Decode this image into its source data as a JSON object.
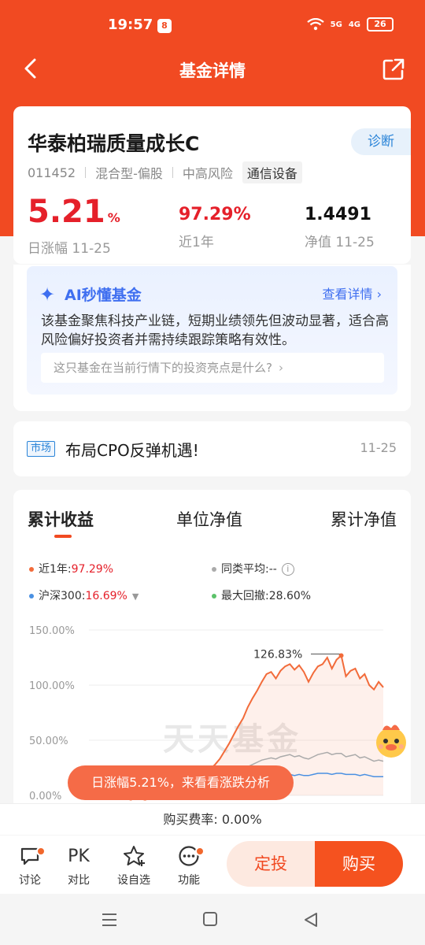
{
  "status": {
    "time": "19:57",
    "app_glyph": "8",
    "network1": "5G",
    "network2": "4G",
    "battery": "26"
  },
  "nav": {
    "title": "基金详情"
  },
  "fund": {
    "name": "华泰柏瑞质量成长C",
    "diagnose_label": "诊断",
    "code": "011452",
    "type": "混合型-偏股",
    "risk": "中高风险",
    "sector": "通信设备",
    "daily_change_value": "5.21",
    "daily_change_unit": "%",
    "daily_change_label": "日涨幅 11-25",
    "year_return_value": "97.29%",
    "year_return_label": "近1年",
    "nav_value": "1.4491",
    "nav_label": "净值 11-25"
  },
  "ai": {
    "title": "AI秒懂基金",
    "more": "查看详情",
    "description": "该基金聚焦科技产业链，短期业绩领先但波动显著，适合高风险偏好投资者并需持续跟踪策略有效性。",
    "question": "这只基金在当前行情下的投资亮点是什么?"
  },
  "news": {
    "tag": "市场",
    "text": "布局CPO反弹机遇!",
    "date": "11-25"
  },
  "chart_tabs": [
    "累计收益",
    "单位净值",
    "累计净值"
  ],
  "legend": {
    "near_year_label": "近1年:",
    "near_year_value": "97.29%",
    "peer_label": "同类平均:--",
    "hs300_label": "沪深300:",
    "hs300_value": "16.69%",
    "drawdown_label": "最大回撤:28.60%"
  },
  "colors": {
    "fund": "#f26b3a",
    "peer": "#aaaaaa",
    "hs300": "#4a90e2",
    "drawdown": "#5cc26a",
    "accent": "#f14a22"
  },
  "chart_data": {
    "type": "line",
    "yticks": [
      "150.00%",
      "100.00%",
      "50.00%",
      "0.00%"
    ],
    "ylim": [
      0,
      150
    ],
    "peak_label": "126.83%",
    "peak_value": 126.83,
    "watermark": "天天基金",
    "series": [
      {
        "name": "近1年",
        "values": [
          0,
          -1,
          0,
          -2,
          -3,
          -2,
          -1,
          -2,
          -3,
          -4,
          -2,
          -3,
          -4,
          -3,
          -2,
          -1,
          0,
          1,
          2,
          3,
          5,
          8,
          11,
          14,
          17,
          20,
          24,
          28,
          33,
          40,
          47,
          55,
          63,
          70,
          80,
          88,
          95,
          103,
          110,
          112,
          106,
          113,
          117,
          119,
          114,
          118,
          112,
          103,
          111,
          117,
          119,
          125,
          115,
          123,
          126.83,
          108,
          113,
          115,
          106,
          110,
          100,
          96,
          103,
          98
        ]
      },
      {
        "name": "同类平均",
        "values": [
          0,
          0,
          -1,
          -1,
          -2,
          -1,
          -1,
          -2,
          -2,
          -2,
          -1,
          -2,
          -2,
          -1,
          -1,
          0,
          0,
          1,
          1,
          2,
          3,
          4,
          5,
          6,
          7,
          8,
          10,
          12,
          13,
          15,
          17,
          19,
          21,
          24,
          26,
          28,
          30,
          32,
          33,
          34,
          33,
          35,
          36,
          37,
          35,
          36,
          34,
          33,
          35,
          37,
          38,
          39,
          37,
          38,
          38,
          35,
          36,
          37,
          34,
          35,
          33,
          31,
          32,
          31
        ]
      },
      {
        "name": "沪深300",
        "values": [
          0,
          0,
          0,
          -1,
          -1,
          -1,
          0,
          -1,
          -1,
          -1,
          0,
          -1,
          -1,
          0,
          0,
          0,
          1,
          1,
          1,
          2,
          2,
          3,
          4,
          4,
          5,
          6,
          7,
          8,
          8,
          9,
          10,
          11,
          12,
          13,
          14,
          15,
          16,
          17,
          17,
          18,
          18,
          19,
          19,
          19,
          18,
          19,
          18,
          18,
          19,
          20,
          20,
          20,
          19,
          20,
          20,
          19,
          19,
          19,
          18,
          19,
          18,
          17,
          17,
          17
        ]
      }
    ]
  },
  "pill": "日涨幅5.21%，来看看涨跌分析",
  "fee": "购买费率: 0.00%",
  "bottom": {
    "discuss": "讨论",
    "pk": "PK",
    "compare": "对比",
    "watch": "设自选",
    "func": "功能",
    "dingtou": "定投",
    "buy": "购买"
  }
}
